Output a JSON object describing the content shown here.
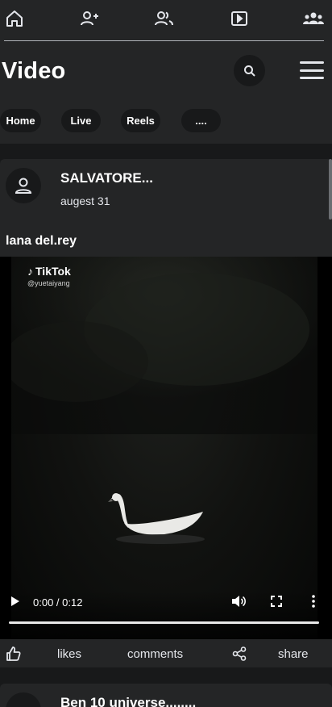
{
  "topnav": {
    "icons": [
      "home-icon",
      "add-friend-icon",
      "friends-icon",
      "video-icon",
      "groups-icon"
    ]
  },
  "header": {
    "title": "Video",
    "search_icon": "search-icon",
    "menu_icon": "hamburger-menu-icon"
  },
  "tabs": [
    {
      "label": "Home"
    },
    {
      "label": "Live"
    },
    {
      "label": "Reels"
    },
    {
      "label": "...."
    }
  ],
  "post": {
    "author": "SALVATORE...",
    "date": "augest 31",
    "caption": "lana del.rey",
    "video": {
      "watermark_brand": "TikTok",
      "watermark_handle": "@yuetaiyang",
      "time": "0:00 / 0:12",
      "progress": 0
    },
    "actions": {
      "likes": "likes",
      "comments": "comments",
      "share": "share"
    }
  },
  "next_post": {
    "author": "Ben 10 universe........"
  },
  "colors": {
    "background": "#18191a",
    "surface": "#242526",
    "text": "#e4e6eb"
  }
}
